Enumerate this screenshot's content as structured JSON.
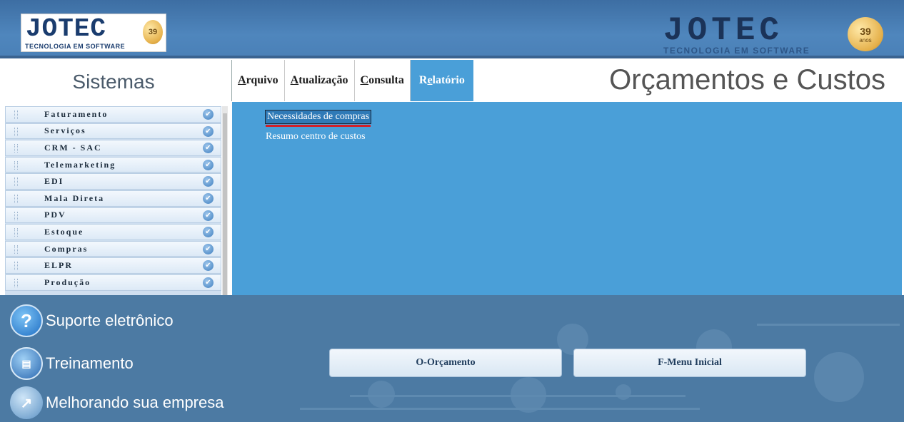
{
  "header": {
    "logo_left": {
      "word": "JOTEC",
      "tagline": "TECNOLOGIA EM SOFTWARE",
      "badge": "39"
    },
    "logo_right": {
      "word": "JOTEC",
      "tagline": "TECNOLOGIA EM SOFTWARE",
      "badge": "39",
      "badge_sub": "anos"
    }
  },
  "sidebar": {
    "title": "Sistemas",
    "modules": [
      {
        "label": "Faturamento"
      },
      {
        "label": "Serviços"
      },
      {
        "label": "CRM - SAC"
      },
      {
        "label": "Telemarketing"
      },
      {
        "label": "EDI"
      },
      {
        "label": "Mala Direta"
      },
      {
        "label": "PDV"
      },
      {
        "label": "Estoque"
      },
      {
        "label": "Compras"
      },
      {
        "label": "ELPR"
      },
      {
        "label": "Produção"
      }
    ]
  },
  "menu": {
    "items": [
      {
        "pre": "",
        "key": "A",
        "post": "rquivo"
      },
      {
        "pre": "",
        "key": "A",
        "post": "tualização"
      },
      {
        "pre": "",
        "key": "C",
        "post": "onsulta"
      },
      {
        "pre": "R",
        "key": "e",
        "post": "latório"
      }
    ],
    "active_index": 3
  },
  "page_title": "Orçamentos e Custos",
  "submenu": {
    "items": [
      "Necessidades de compras",
      "Resumo centro de custos"
    ],
    "selected_index": 0
  },
  "footer": {
    "links": [
      "Suporte eletrônico",
      "Treinamento",
      "Melhorando sua empresa"
    ],
    "buttons": [
      "O-Orçamento",
      "F-Menu Inicial"
    ]
  },
  "colors": {
    "header_blue": "#4f86bd",
    "panel_blue": "#4a9fd8",
    "footer_blue": "#4c7aa3",
    "selection_underline": "#d0202a"
  },
  "icons": [
    "check-circle-icon",
    "help-icon",
    "training-icon",
    "growth-chart-icon"
  ]
}
